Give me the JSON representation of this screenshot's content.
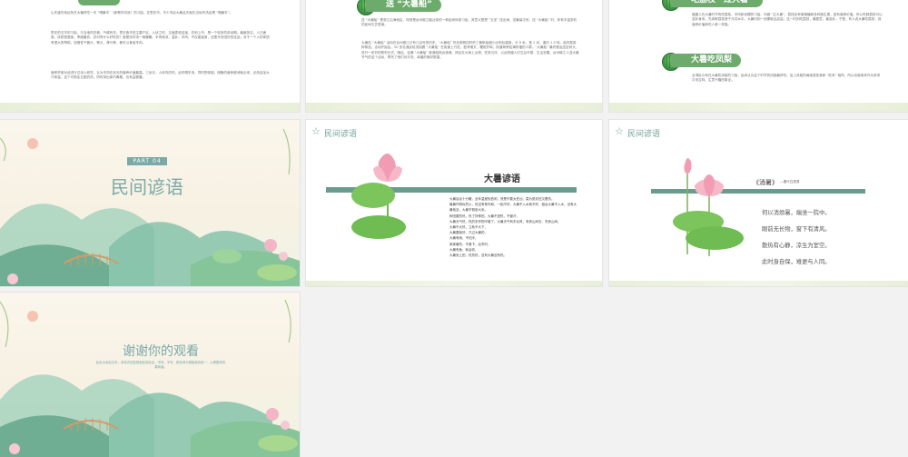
{
  "slide1": {
    "para1": "山东潍坊地区有在大暑时吃一天 “喝暑羊”（即喝羊肉汤）的习俗。在枣庄市，不少市民大暑这天就在当地羊汤店喝 “喝暑羊”。",
    "para2": "枣庄的汉羊的习俗，与当地的农事、气候有关。枣庄食羊的主要产区，入伏之时，正值麦收结束，农闲上市，是一个较多的劳动期。最疲劳过，人已疲惫，体质很差极，季度暑热。农村有什么好吃的？就是用羊汤一碗暖暖。羊肉味浓，温补。羊肉，不仅能强身，还是天然进补的佳品，对于一个人的体质有很大的帮助，如慢性气管炎、胃炎，肾亏等，都可以食用羊肉。",
    "para3": "营养学家对此进行过深入研究，认为羊肉在伏天的营养价值最高。三伏天，人体内的热，此时喝羊汤，同时把体能、储备的营养都消耗出来、必然会加大汗体温，这个可带走五脏的热，同时排出体内毒素，也有益健康。"
  },
  "slide2": {
    "header": "送 “大暑船”",
    "para1": "送 “大暑船” 是浙江沿海地区，特别是台州椒江葭沚街的一种民间传统习俗，其意义是把 “五圣” 送出海，送暑保平安。送 “大暑船” 时，伴有丰富多彩的民间文艺表演。",
    "para2": "大暑送 “大暑船” 活动在台州椒江已有几百年的历史。“大暑船” 完全按照旧时的三桅帆船缩小比例后建造，长 8 米，宽 2 米，重约 1.5 吨，船内载各种祭品。活动开始后，50 多名渔民轮流抬着 “大暑船” 在街道上行进，鼓号喧天，鞭炮齐鸣，街道两旁站满祈福的人群。“大暑船” 最终被运送至码头，进行一系列的祭祀仪式。随后，这艘 “大暑船” 被渔船拖出渔港，然后在大海上点燃，任其沉浮，以此祝福人们五谷丰登，生活安康。台州椒江人送大暑节气的这个活动，寄托了他们对平安、幸福的美好愿望。"
  },
  "slide3": {
    "header1": "吃荔枝 “过大暑”",
    "para1": "福建人在大暑时节有吃荔枝、羊肉和米糟的习俗，叫做 “过大暑”。荔枝含有葡萄糖和多种维生素，富有营养价值，所以吃鲜荔枝可以滋补身体。先将鲜荔枝浸于冷井水中，大暑时刻一到便取出品尝。这一时刻吃荔枝，最惬意、最滋补。于是，有人说大暑吃荔枝，其营养价值和吃人参一样高。",
    "header2": "大暑吃凤梨",
    "para2": "台湾民众有在大暑吃凤梨的习俗，民间认为这个时节的凤梨最好吃。加上凤梨的闽南语发音和 “旺来” 相同，所以也被用来作为祈求平安吉祥、生意兴隆的象征。"
  },
  "slide4": {
    "part_label": "PART 04",
    "title": "民间谚语"
  },
  "slide5": {
    "corner_title": "民间谚语",
    "title": "大暑谚语",
    "body": "大暑谷谷十分暖，全年温差较低闲，快是不要太任凶，莫为夏初还欠着热。\n最暑作物似烈火，但没有条件和，一稻不好，大暑不入水就不好，稻谷大暑不入水，没有大暑就没，大暑不割前大米。\n种田要热热，热了好种田。大暑不进热，不管冷，\n大暑天气热，热的农作物不管了，大暑天气有东北风，有到山间去，冬到山间。\n大暑不大热，立秋不大下，\n大暑要就好，只过大暑的，\n大暑有雨，不怕冷，\n家家暑热，不落下，后冬时，\n大暑有鱼，秋后收，\n大暑到上田，热热热，没有大暑没有热。"
  },
  "slide6": {
    "corner_title": "民间谚语",
    "poem_title": "《消暑》",
    "poem_author": "—唐代白居易",
    "lines": [
      "何以消烦暑，端坐一院中。",
      "眼前无长物，窗下有清风。",
      "散热有心静，凉生为室空。",
      "此时身自保，难更与人同。"
    ]
  },
  "slide7": {
    "title": "谢谢你的观看",
    "subtitle": "此处为添加文本，请将内容复制粘贴到此处，字体、字号、颜色请与模板保持统一，以便整体效果和谐。"
  },
  "colors": {
    "accent_green": "#6cab6c",
    "teal": "#6a9c8e",
    "title_teal": "#7aa9a7"
  }
}
